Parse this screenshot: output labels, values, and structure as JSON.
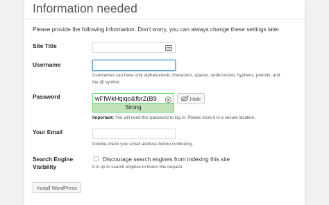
{
  "heading": "Information needed",
  "intro": "Please provide the following information. Don't worry, you can always change these settings later.",
  "fields": {
    "site_title": {
      "label": "Site Title",
      "value": ""
    },
    "username": {
      "label": "Username",
      "value": "",
      "desc_line1": "Usernames can have only alphanumeric characters, spaces, underscores, hyphens, periods, and",
      "desc_line2": "the @ symbol."
    },
    "password": {
      "label": "Password",
      "value": "wFfWkHqiqo&fbrZ(B9",
      "strength": "Strong",
      "hide_label": "Hide",
      "important_label": "Important:",
      "important_text": " You will need this password to log in. Please store it in a secure location."
    },
    "email": {
      "label": "Your Email",
      "value": "",
      "desc": "Double-check your email address before continuing."
    },
    "search": {
      "label_line1": "Search Engine",
      "label_line2": "Visibility",
      "checkbox_label": "Discourage search engines from indexing this site",
      "checked": false,
      "desc": "It is up to search engines to honor this request."
    }
  },
  "submit_label": "Install WordPress",
  "colors": {
    "focus_border": "#5b9dd9",
    "strong_bg": "#c1e1b9",
    "strong_border": "#68de7c"
  }
}
